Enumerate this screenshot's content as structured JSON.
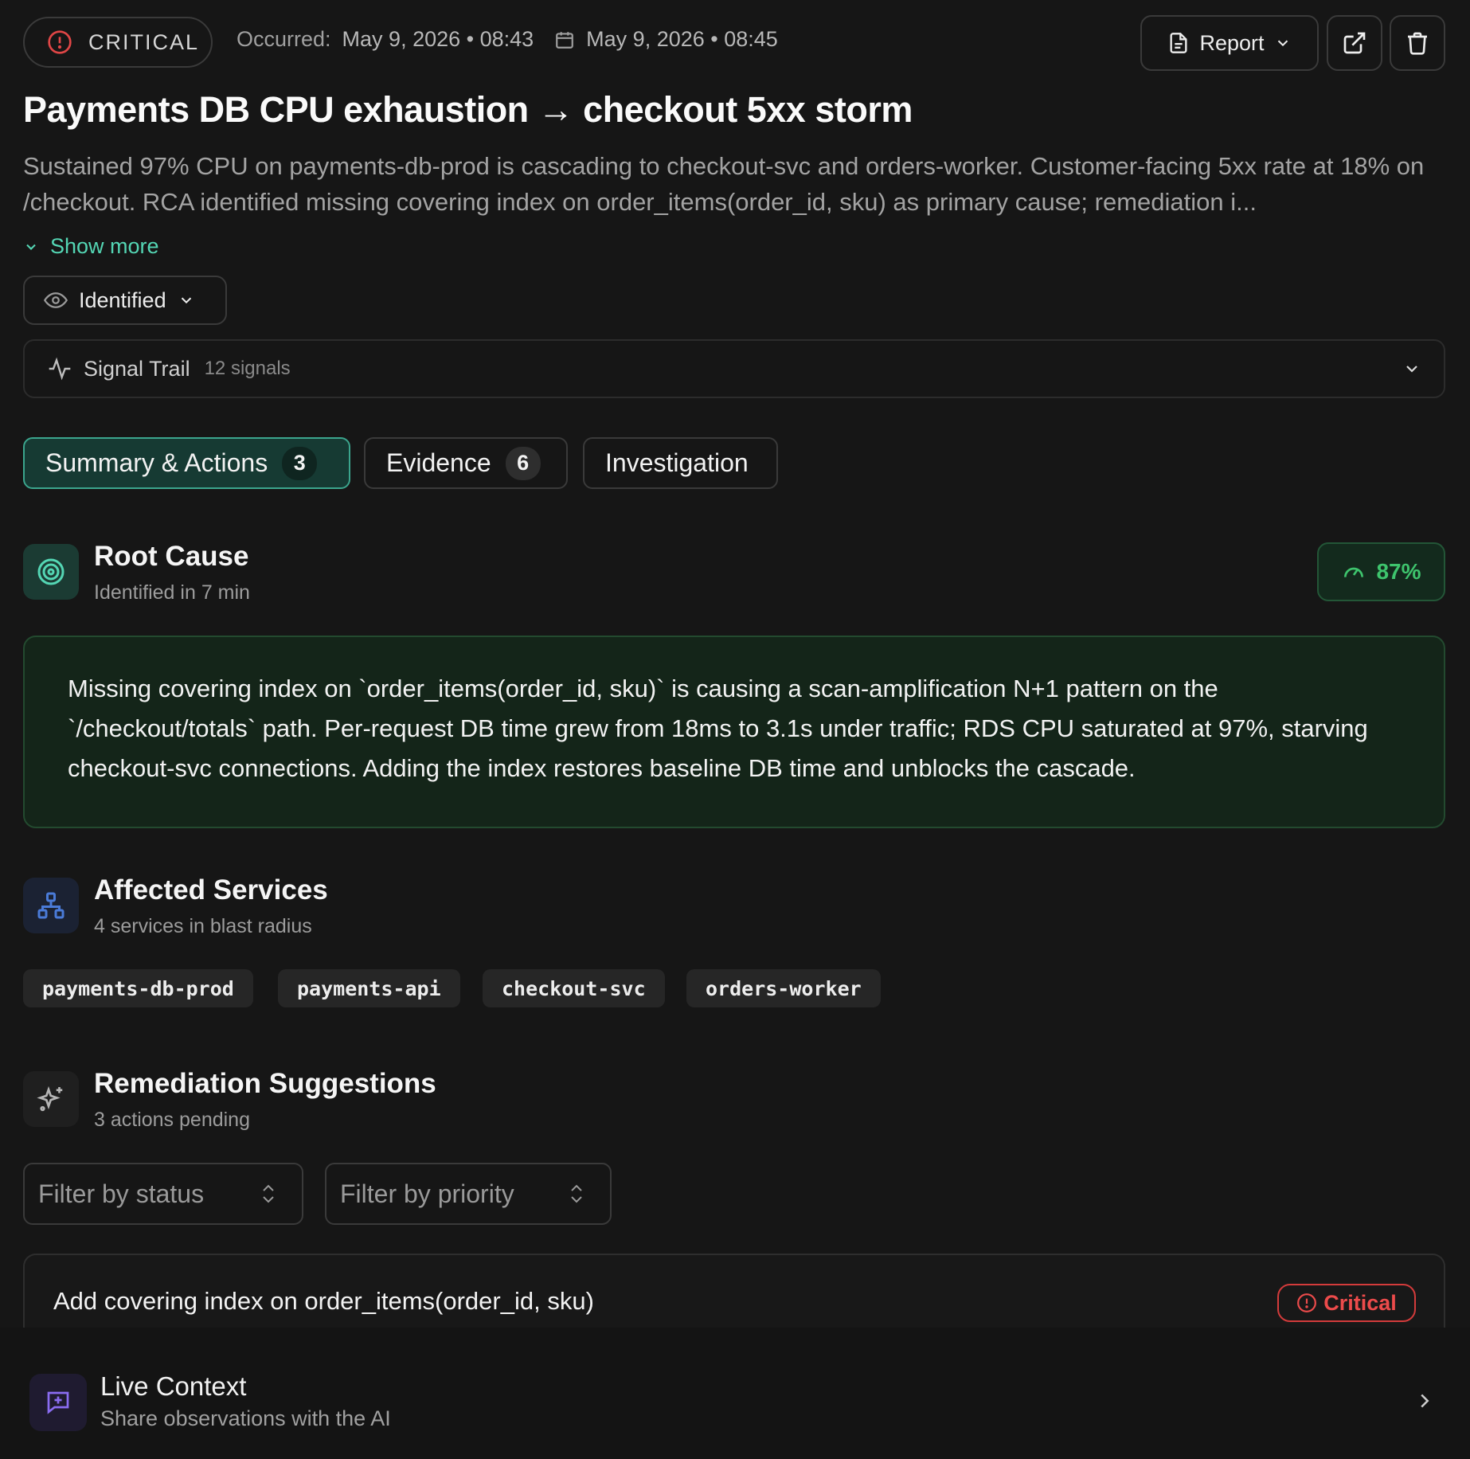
{
  "incident": {
    "severity": "CRITICAL",
    "occurred_label": "Occurred:",
    "occurred_at": "May 9, 2026 • 08:43",
    "updated_at": "May 9, 2026 • 08:45",
    "title": "Payments DB CPU exhaustion → checkout 5xx storm",
    "description": "Sustained 97% CPU on payments-db-prod is cascading to checkout-svc and orders-worker. Customer-facing 5xx rate at 18% on /checkout. RCA identified missing covering index on order_items(order_id, sku) as primary cause; remediation i...",
    "show_more": "Show more",
    "status": "Identified"
  },
  "toolbar": {
    "report_label": "Report",
    "open_icon": "external-link-icon",
    "delete_icon": "trash-icon"
  },
  "signal_trail": {
    "label": "Signal Trail",
    "count": "12 signals"
  },
  "tabs": [
    {
      "label": "Summary & Actions",
      "badge": "3",
      "active": true
    },
    {
      "label": "Evidence",
      "badge": "6",
      "active": false
    },
    {
      "label": "Investigation",
      "badge": "",
      "active": false
    }
  ],
  "root_cause": {
    "title": "Root Cause",
    "subtitle": "Identified in 7 min",
    "confidence": "87%",
    "text": "Missing covering index on `order_items(order_id, sku)` is causing a scan-amplification N+1 pattern on the `/checkout/totals` path. Per-request DB time grew from 18ms to 3.1s under traffic; RDS CPU saturated at 97%, starving checkout-svc connections. Adding the index restores baseline DB time and unblocks the cascade."
  },
  "affected": {
    "title": "Affected Services",
    "subtitle": "4 services in blast radius",
    "services": [
      "payments-db-prod",
      "payments-api",
      "checkout-svc",
      "orders-worker"
    ]
  },
  "remediation": {
    "title": "Remediation Suggestions",
    "subtitle": "3 actions pending",
    "filter_status": "Filter by status",
    "filter_priority": "Filter by priority",
    "first_action": {
      "title": "Add covering index on order_items(order_id, sku)",
      "priority": "Critical"
    }
  },
  "live_context": {
    "title": "Live Context",
    "subtitle": "Share observations with the AI"
  },
  "colors": {
    "background": "#161616",
    "accent_teal": "#54d6b4",
    "critical_red": "#ec4b4b",
    "confidence_green": "#3ec46d",
    "services_blue": "#4a7bd8",
    "live_purple": "#8a6cf0"
  }
}
